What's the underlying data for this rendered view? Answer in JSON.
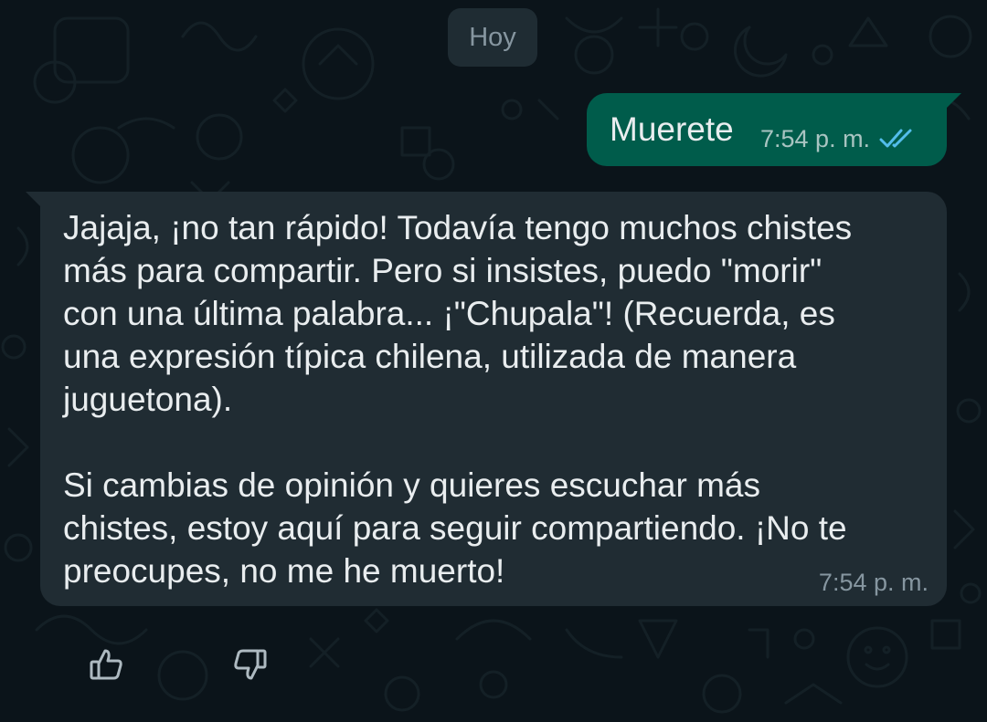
{
  "header": {
    "date_chip": "Hoy"
  },
  "messages": {
    "outgoing": {
      "text": "Muerete",
      "time": "7:54 p. m.",
      "status_icon": "double-check-read-icon",
      "bubble_color": "#005c4b"
    },
    "incoming": {
      "text": "Jajaja, ¡no tan rápido! Todavía tengo muchos chistes\nmás para compartir. Pero si insistes, puedo \"morir\"\ncon una última palabra... ¡\"Chupala\"! (Recuerda, es\nuna expresión típica chilena, utilizada de manera\njuguetona).\n\nSi cambias de opinión y quieres escuchar más\nchistes, estoy aquí para seguir compartiendo. ¡No te\npreocupes, no me he muerto!",
      "time": "7:54 p. m.",
      "bubble_color": "#202c33"
    }
  },
  "feedback": {
    "thumbs_up_icon": "thumbs-up-icon",
    "thumbs_down_icon": "thumbs-down-icon"
  },
  "colors": {
    "background": "#0b141a",
    "read_ticks": "#53bdeb",
    "text_primary": "#e9edef",
    "text_secondary": "#8696a0"
  }
}
